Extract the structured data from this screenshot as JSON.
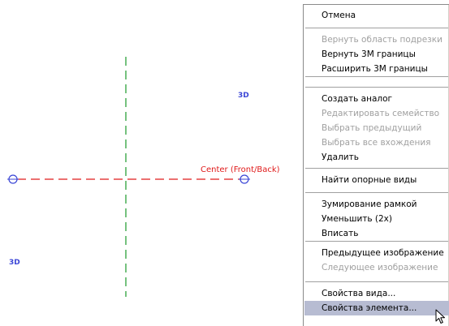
{
  "viewport": {
    "markers": [
      {
        "id": "marker-3d-right",
        "label": "3D"
      },
      {
        "id": "marker-3d-left",
        "label": "3D"
      }
    ],
    "reference_plane_label": "Center (Front/Back)",
    "colors": {
      "reference_plane": "#e01a1a",
      "axis_line": "#1a9a2a",
      "marker": "#3b46d6"
    }
  },
  "context_menu": {
    "groups": [
      [
        {
          "label": "Отмена",
          "enabled": true
        }
      ],
      [
        {
          "label": "Вернуть область подрезки",
          "enabled": false
        },
        {
          "label": "Вернуть 3М границы",
          "enabled": true
        },
        {
          "label": "Расширить 3М границы",
          "enabled": true
        }
      ],
      [],
      [
        {
          "label": "Создать аналог",
          "enabled": true
        },
        {
          "label": "Редактировать семейство",
          "enabled": false
        },
        {
          "label": "Выбрать предыдущий",
          "enabled": false
        },
        {
          "label": "Выбрать все вхождения",
          "enabled": false
        },
        {
          "label": "Удалить",
          "enabled": true
        }
      ],
      [
        {
          "label": "Найти опорные виды",
          "enabled": true
        }
      ],
      [
        {
          "label": "Зумирование рамкой",
          "enabled": true
        },
        {
          "label": "Уменьшить (2x)",
          "enabled": true
        },
        {
          "label": "Вписать",
          "enabled": true
        }
      ],
      [
        {
          "label": "Предыдущее изображение",
          "enabled": true
        },
        {
          "label": "Следующее изображение",
          "enabled": false
        }
      ],
      [
        {
          "label": "Свойства вида...",
          "enabled": true
        },
        {
          "label": "Свойства элемента...",
          "enabled": true,
          "highlighted": true
        }
      ]
    ],
    "highlight_color": "#b7bcd2",
    "disabled_color": "#a0a0a0"
  },
  "cursor": {
    "icon": "arrow-pointer-icon"
  }
}
